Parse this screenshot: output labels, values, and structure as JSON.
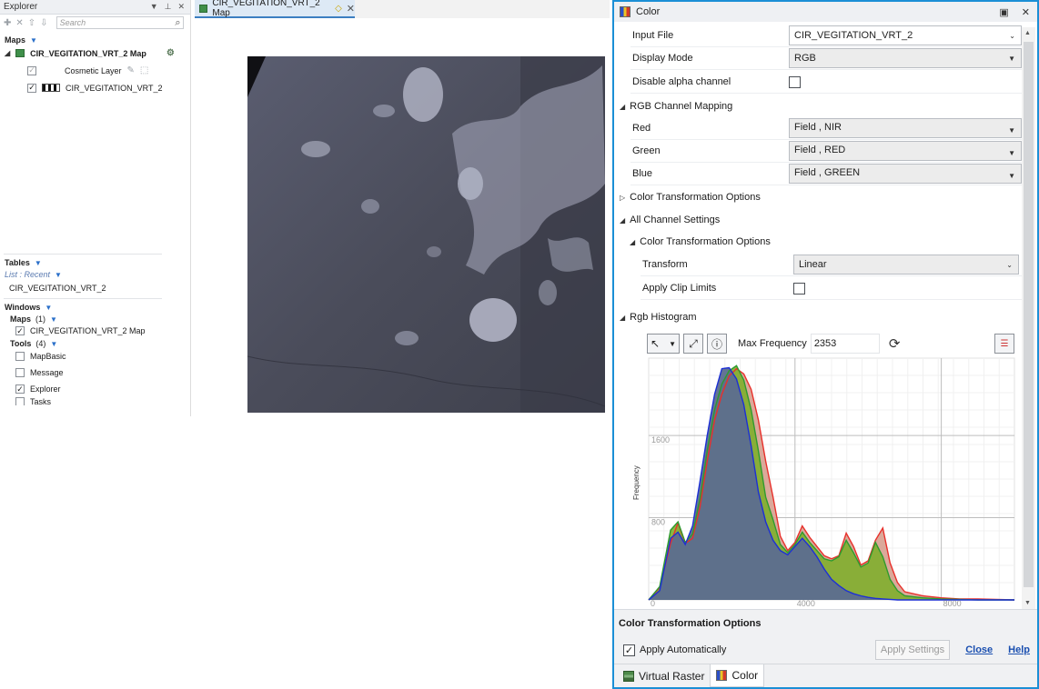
{
  "explorer": {
    "title": "Explorer",
    "search_placeholder": "Search",
    "maps_section": "Maps",
    "map_name": "CIR_VEGITATION_VRT_2 Map",
    "layers": [
      {
        "label": "Cosmetic Layer",
        "checked": true
      },
      {
        "label": "CIR_VEGITATION_VRT_2",
        "checked": true
      }
    ],
    "tables_section": "Tables",
    "list_recent": "List : Recent",
    "table_item": "CIR_VEGITATION_VRT_2",
    "windows_section": "Windows",
    "windows_maps_label": "Maps",
    "windows_maps_count": "(1)",
    "windows_map_item": "CIR_VEGITATION_VRT_2 Map",
    "tools_label": "Tools",
    "tools_count": "(4)",
    "tools": [
      {
        "label": "MapBasic",
        "checked": false
      },
      {
        "label": "Message",
        "checked": false
      },
      {
        "label": "Explorer",
        "checked": true
      },
      {
        "label": "Tasks",
        "checked": false
      }
    ]
  },
  "document": {
    "tab_title": "CIR_VEGITATION_VRT_2 Map"
  },
  "color_window": {
    "title": "Color",
    "input_file_label": "Input File",
    "input_file_value": "CIR_VEGITATION_VRT_2",
    "display_mode_label": "Display Mode",
    "display_mode_value": "RGB",
    "disable_alpha_label": "Disable alpha channel",
    "disable_alpha_checked": false,
    "rgb_mapping_header": "RGB Channel Mapping",
    "red_label": "Red",
    "red_value": "Field , NIR",
    "green_label": "Green",
    "green_value": "Field , RED",
    "blue_label": "Blue",
    "blue_value": "Field , GREEN",
    "color_transform_header": "Color Transformation Options",
    "all_channel_header": "All Channel Settings",
    "sub_transform_header": "Color Transformation Options",
    "transform_label": "Transform",
    "transform_value": "Linear",
    "apply_clip_label": "Apply Clip Limits",
    "apply_clip_checked": false,
    "histogram_header": "Rgb Histogram",
    "max_frequency_label": "Max Frequency",
    "max_frequency_value": "2353",
    "bottom_panel_title": "Color Transformation Options",
    "apply_automatically_label": "Apply Automatically",
    "apply_automatically_checked": true,
    "apply_settings_label": "Apply Settings",
    "close_label": "Close",
    "help_label": "Help",
    "tabs": [
      {
        "label": "Virtual Raster",
        "active": false
      },
      {
        "label": "Color",
        "active": true
      }
    ]
  },
  "chart_data": {
    "type": "area",
    "title": "",
    "xlabel": "",
    "ylabel": "Frequency",
    "xlim": [
      0,
      10000
    ],
    "ylim": [
      0,
      2353
    ],
    "x_ticks": [
      0,
      4000,
      8000
    ],
    "y_ticks": [
      800,
      1600
    ],
    "grid": true,
    "colors": {
      "red": "#e8302b",
      "green": "#2e9b2e",
      "blue": "#1c2fd6",
      "fill_red": "#d7a08f",
      "fill_green": "#7fae2e",
      "fill_blue": "#5c6d8f"
    },
    "x": [
      0,
      300,
      600,
      800,
      1000,
      1200,
      1400,
      1600,
      1800,
      2000,
      2200,
      2400,
      2600,
      2800,
      3000,
      3200,
      3400,
      3600,
      3800,
      4000,
      4200,
      4400,
      4600,
      4800,
      5000,
      5200,
      5400,
      5600,
      5800,
      6000,
      6200,
      6400,
      6600,
      6800,
      7000,
      7500,
      8000,
      8500,
      9000,
      9500,
      10000
    ],
    "series": [
      {
        "name": "Red",
        "values": [
          0,
          120,
          550,
          750,
          550,
          600,
          900,
          1350,
          1750,
          2000,
          2180,
          2250,
          2200,
          2050,
          1750,
          1350,
          1000,
          620,
          480,
          560,
          720,
          610,
          520,
          430,
          400,
          430,
          650,
          520,
          340,
          380,
          580,
          700,
          360,
          170,
          80,
          40,
          20,
          10,
          10,
          5,
          0
        ]
      },
      {
        "name": "Green",
        "values": [
          0,
          130,
          680,
          760,
          560,
          640,
          980,
          1450,
          1850,
          2100,
          2230,
          2280,
          2140,
          1850,
          1450,
          1000,
          780,
          540,
          460,
          540,
          660,
          560,
          480,
          400,
          380,
          420,
          580,
          460,
          320,
          360,
          560,
          420,
          200,
          90,
          40,
          20,
          10,
          5,
          0,
          0,
          0
        ]
      },
      {
        "name": "Blue",
        "values": [
          0,
          90,
          600,
          660,
          540,
          720,
          1150,
          1600,
          2000,
          2250,
          2260,
          2150,
          1900,
          1500,
          1050,
          760,
          580,
          480,
          440,
          520,
          600,
          520,
          420,
          300,
          200,
          140,
          90,
          60,
          40,
          25,
          15,
          10,
          5,
          0,
          0,
          0,
          0,
          0,
          0,
          0,
          0
        ]
      }
    ]
  }
}
